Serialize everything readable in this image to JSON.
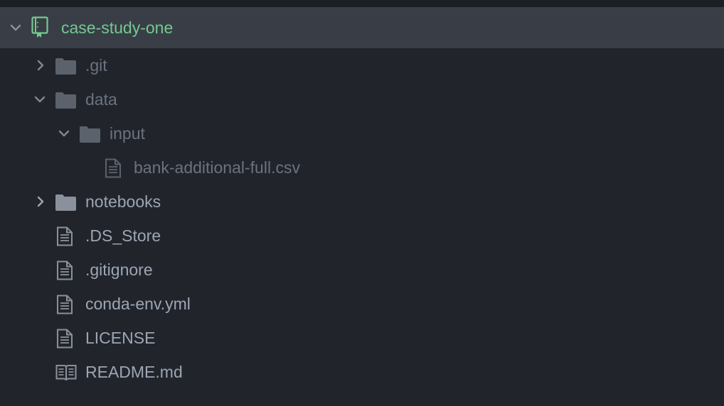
{
  "project": {
    "name": "case-study-one",
    "icon": "repo-book-icon",
    "expanded": true,
    "accent_color": "#73c991"
  },
  "items": [
    {
      "label": ".git",
      "type": "folder",
      "expanded": false,
      "depth": 1,
      "dimmed": true
    },
    {
      "label": "data",
      "type": "folder",
      "expanded": true,
      "depth": 1,
      "dimmed": true
    },
    {
      "label": "input",
      "type": "folder",
      "expanded": true,
      "depth": 2,
      "dimmed": true
    },
    {
      "label": "bank-additional-full.csv",
      "type": "file",
      "depth": 3,
      "dimmed": true
    },
    {
      "label": "notebooks",
      "type": "folder",
      "expanded": false,
      "depth": 1,
      "dimmed": false
    },
    {
      "label": ".DS_Store",
      "type": "file",
      "depth": 1,
      "dimmed": false
    },
    {
      "label": ".gitignore",
      "type": "file",
      "depth": 1,
      "dimmed": false
    },
    {
      "label": "conda-env.yml",
      "type": "file",
      "depth": 1,
      "dimmed": false
    },
    {
      "label": "LICENSE",
      "type": "file",
      "depth": 1,
      "dimmed": false
    },
    {
      "label": "README.md",
      "type": "readme",
      "depth": 1,
      "dimmed": false
    }
  ],
  "colors": {
    "background": "#21252b",
    "selected_row": "#393e46",
    "text": "#9da5b4",
    "text_dimmed": "#6b7280",
    "icon": "#8a919c"
  }
}
